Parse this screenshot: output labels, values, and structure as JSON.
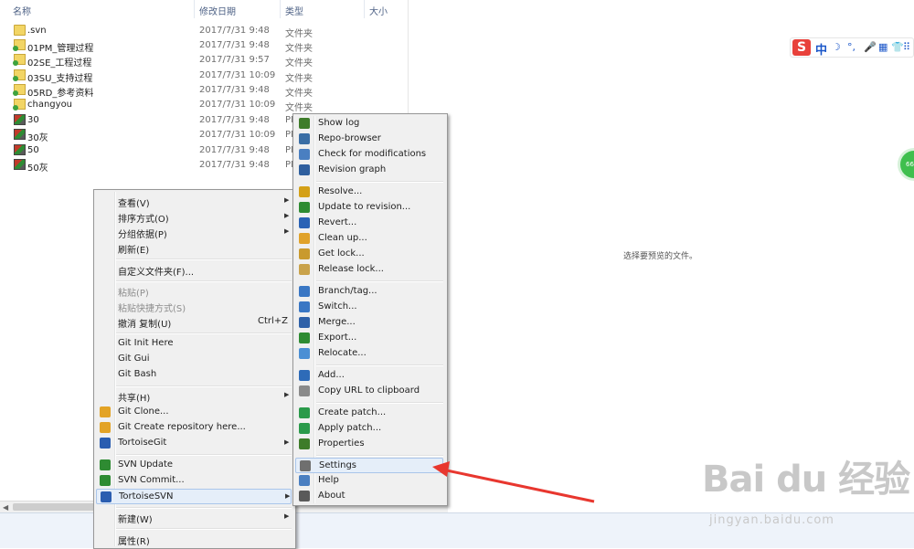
{
  "columns": {
    "name": "名称",
    "modified": "修改日期",
    "type": "类型",
    "size": "大小"
  },
  "files": [
    {
      "name": ".svn",
      "date": "2017/7/31 9:48",
      "type": "文件夹",
      "icon": "folder-icon"
    },
    {
      "name": "01PM_管理过程",
      "date": "2017/7/31 9:48",
      "type": "文件夹",
      "icon": "svn-folder-icon"
    },
    {
      "name": "02SE_工程过程",
      "date": "2017/7/31 9:57",
      "type": "文件夹",
      "icon": "svn-folder-icon"
    },
    {
      "name": "03SU_支持过程",
      "date": "2017/7/31 10:09",
      "type": "文件夹",
      "icon": "svn-folder-icon"
    },
    {
      "name": "05RD_参考资料",
      "date": "2017/7/31 9:48",
      "type": "文件夹",
      "icon": "svn-folder-icon"
    },
    {
      "name": "changyou",
      "date": "2017/7/31 10:09",
      "type": "文件夹",
      "icon": "svn-folder-icon"
    },
    {
      "name": "30",
      "date": "2017/7/31 9:48",
      "type": "PN",
      "icon": "image-file-icon"
    },
    {
      "name": "30灰",
      "date": "2017/7/31 10:09",
      "type": "PN",
      "icon": "image-file-icon"
    },
    {
      "name": "50",
      "date": "2017/7/31 9:48",
      "type": "PN",
      "icon": "image-file-icon"
    },
    {
      "name": "50灰",
      "date": "2017/7/31 9:48",
      "type": "PN",
      "icon": "image-file-icon"
    }
  ],
  "preview": {
    "text": "选择要预览的文件。"
  },
  "ime": {
    "logo": "S",
    "mode": "中",
    "glyphs": [
      "☽",
      "°,",
      "🎤",
      "▦",
      "👕",
      "⠿"
    ]
  },
  "float_ball": {
    "text": "66"
  },
  "context_menu": {
    "items": [
      {
        "label": "查看(V)",
        "arrow": "▶"
      },
      {
        "label": "排序方式(O)",
        "arrow": "▶"
      },
      {
        "label": "分组依据(P)",
        "arrow": "▶"
      },
      {
        "label": "刷新(E)"
      },
      {
        "label": "自定义文件夹(F)..."
      },
      {
        "label": "粘贴(P)"
      },
      {
        "label": "粘贴快捷方式(S)"
      },
      {
        "label": "撤消 复制(U)",
        "shortcut": "Ctrl+Z"
      },
      {
        "label": "Git Init Here"
      },
      {
        "label": "Git Gui"
      },
      {
        "label": "Git Bash"
      },
      {
        "label": "共享(H)",
        "arrow": "▶"
      },
      {
        "label": "Git Clone..."
      },
      {
        "label": "Git Create repository here..."
      },
      {
        "label": "TortoiseGit",
        "arrow": "▶"
      },
      {
        "label": "SVN Update"
      },
      {
        "label": "SVN Commit..."
      },
      {
        "label": "TortoiseSVN",
        "arrow": "▶"
      },
      {
        "label": "新建(W)",
        "arrow": "▶"
      },
      {
        "label": "属性(R)"
      }
    ]
  },
  "svn_menu": {
    "items": [
      {
        "label": "Show log",
        "icon": "show-log-icon",
        "color": "#3e7c2a"
      },
      {
        "label": "Repo-browser",
        "icon": "repo-browser-icon",
        "color": "#3a6ea5"
      },
      {
        "label": "Check for modifications",
        "icon": "check-modifications-icon",
        "color": "#4a7fc1"
      },
      {
        "label": "Revision graph",
        "icon": "revision-graph-icon",
        "color": "#2f5f9e"
      },
      {
        "label": "Resolve...",
        "icon": "resolve-icon",
        "color": "#d4a017"
      },
      {
        "label": "Update to revision...",
        "icon": "update-to-revision-icon",
        "color": "#2e8b32"
      },
      {
        "label": "Revert...",
        "icon": "revert-icon",
        "color": "#2a62b5"
      },
      {
        "label": "Clean up...",
        "icon": "clean-up-icon",
        "color": "#e0a22a"
      },
      {
        "label": "Get lock...",
        "icon": "get-lock-icon",
        "color": "#c99a2e"
      },
      {
        "label": "Release lock...",
        "icon": "release-lock-icon",
        "color": "#c9a24a"
      },
      {
        "label": "Branch/tag...",
        "icon": "branch-tag-icon",
        "color": "#3a77c4"
      },
      {
        "label": "Switch...",
        "icon": "switch-icon",
        "color": "#3a77c4"
      },
      {
        "label": "Merge...",
        "icon": "merge-icon",
        "color": "#2f61a8"
      },
      {
        "label": "Export...",
        "icon": "export-icon",
        "color": "#2e8b32"
      },
      {
        "label": "Relocate...",
        "icon": "relocate-icon",
        "color": "#4b8fd4"
      },
      {
        "label": "Add...",
        "icon": "add-icon",
        "color": "#2e6bb8"
      },
      {
        "label": "Copy URL to clipboard",
        "icon": "copy-url-icon",
        "color": "#8a8a8a"
      },
      {
        "label": "Create patch...",
        "icon": "create-patch-icon",
        "color": "#2a9a4a"
      },
      {
        "label": "Apply patch...",
        "icon": "apply-patch-icon",
        "color": "#2a9a4a"
      },
      {
        "label": "Properties",
        "icon": "properties-icon",
        "color": "#3e7c2a"
      },
      {
        "label": "Settings",
        "icon": "settings-icon",
        "color": "#6f6f6f"
      },
      {
        "label": "Help",
        "icon": "help-icon",
        "color": "#4a7fc1"
      },
      {
        "label": "About",
        "icon": "about-icon",
        "color": "#5a5a5a"
      }
    ]
  },
  "watermark": {
    "logo": "Bai du 经验",
    "url": "jingyan.baidu.com"
  }
}
